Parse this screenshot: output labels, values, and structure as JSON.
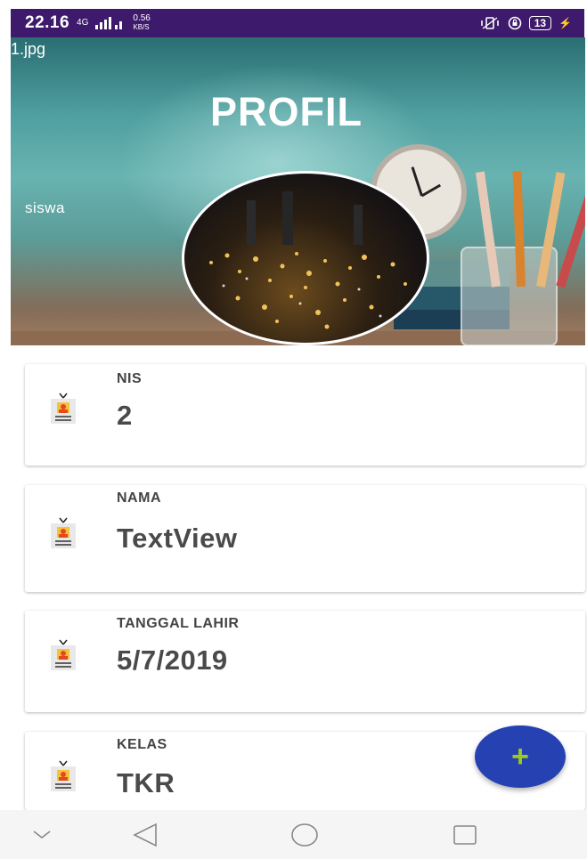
{
  "status_bar": {
    "time": "22.16",
    "network_type": "4G",
    "speed": "0.56",
    "speed_unit": "KB/S",
    "battery": "13"
  },
  "header": {
    "filename": "1.jpg",
    "title": "PROFIL",
    "role": "siswa"
  },
  "cards": [
    {
      "label": "NIS",
      "value": "2"
    },
    {
      "label": "NAMA",
      "value": "TextView"
    },
    {
      "label": "TANGGAL LAHIR",
      "value": "5/7/2019"
    },
    {
      "label": "KELAS",
      "value": "TKR"
    }
  ],
  "fab": {
    "label": "+"
  },
  "colors": {
    "status_bar": "#3d1a6b",
    "fab": "#2541b2",
    "fab_icon": "#9ccc1a"
  },
  "icons": [
    "id-card-icon",
    "back-icon",
    "home-icon",
    "recents-icon",
    "chevron-down-icon"
  ]
}
